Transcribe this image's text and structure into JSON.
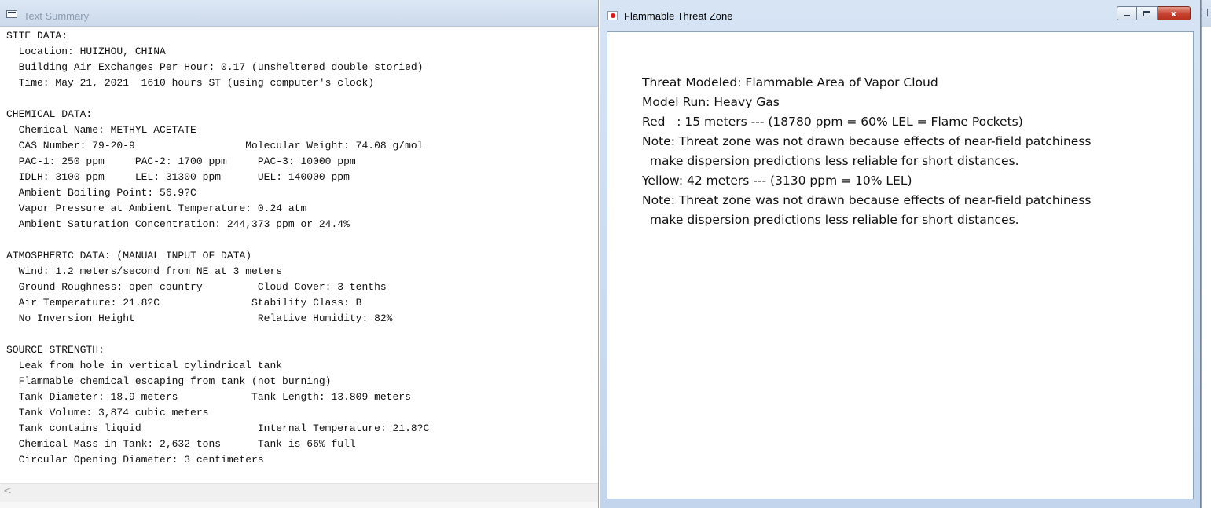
{
  "text_summary_window": {
    "title": "Text Summary",
    "lines": [
      "SITE DATA:",
      "  Location: HUIZHOU, CHINA",
      "  Building Air Exchanges Per Hour: 0.17 (unsheltered double storied)",
      "  Time: May 21, 2021  1610 hours ST (using computer's clock)",
      "",
      "CHEMICAL DATA:",
      "  Chemical Name: METHYL ACETATE",
      "  CAS Number: 79-20-9                  Molecular Weight: 74.08 g/mol",
      "  PAC-1: 250 ppm     PAC-2: 1700 ppm     PAC-3: 10000 ppm",
      "  IDLH: 3100 ppm     LEL: 31300 ppm      UEL: 140000 ppm",
      "  Ambient Boiling Point: 56.9?C",
      "  Vapor Pressure at Ambient Temperature: 0.24 atm",
      "  Ambient Saturation Concentration: 244,373 ppm or 24.4%",
      "",
      "ATMOSPHERIC DATA: (MANUAL INPUT OF DATA)",
      "  Wind: 1.2 meters/second from NE at 3 meters",
      "  Ground Roughness: open country         Cloud Cover: 3 tenths",
      "  Air Temperature: 21.8?C               Stability Class: B",
      "  No Inversion Height                    Relative Humidity: 82%",
      "",
      "SOURCE STRENGTH:",
      "  Leak from hole in vertical cylindrical tank",
      "  Flammable chemical escaping from tank (not burning)",
      "  Tank Diameter: 18.9 meters            Tank Length: 13.809 meters",
      "  Tank Volume: 3,874 cubic meters",
      "  Tank contains liquid                   Internal Temperature: 21.8?C",
      "  Chemical Mass in Tank: 2,632 tons      Tank is 66% full",
      "  Circular Opening Diameter: 3 centimeters"
    ],
    "scroll_left_glyph": "<"
  },
  "threat_zone_window": {
    "title": "Flammable Threat Zone",
    "controls": {
      "close_glyph": "x"
    },
    "lines": [
      "Threat Modeled: Flammable Area of Vapor Cloud",
      "Model Run: Heavy Gas",
      "Red   : 15 meters --- (18780 ppm = 60% LEL = Flame Pockets)",
      "Note: Threat zone was not drawn because effects of near-field patchiness",
      "  make dispersion predictions less reliable for short distances.",
      "Yellow: 42 meters --- (3130 ppm = 10% LEL)",
      "Note: Threat zone was not drawn because effects of near-field patchiness",
      "  make dispersion predictions less reliable for short distances."
    ]
  }
}
